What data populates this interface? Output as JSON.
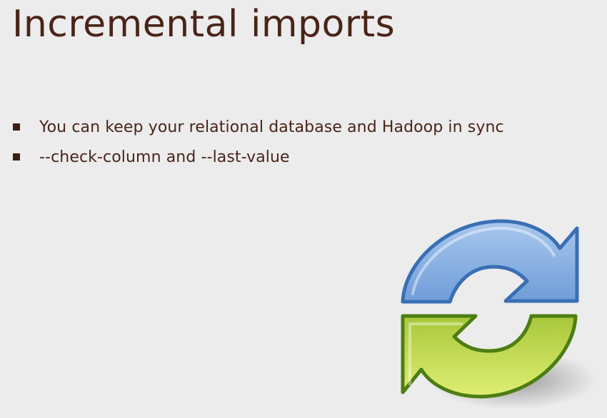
{
  "slide": {
    "title": "Incremental imports",
    "bullets": [
      "You can keep your relational database and Hadoop in sync",
      "--check-column and --last-value"
    ]
  },
  "graphic": {
    "icon": "refresh-icon",
    "colors": {
      "top_arrow_fill": "#8db3e2",
      "top_arrow_stroke": "#3a6fb5",
      "bottom_arrow_fill": "#b9d64f",
      "bottom_arrow_stroke": "#4c7e12",
      "title_color": "#4a2418",
      "background": "#ececec"
    }
  }
}
